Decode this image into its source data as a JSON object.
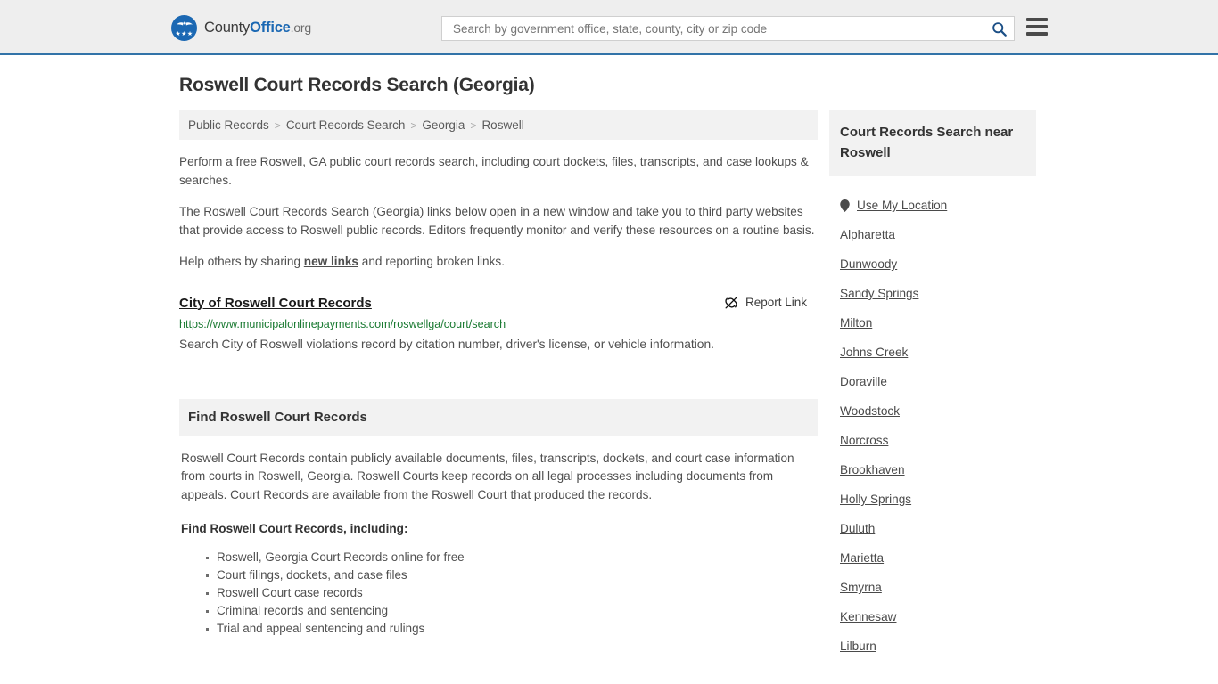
{
  "header": {
    "brand": {
      "part1": "County",
      "part2": "Office",
      "part3": ".org",
      "logo_icon": "eagle-shield-logo",
      "stars": "★★★"
    },
    "search": {
      "placeholder": "Search by government office, state, county, city or zip code",
      "value": "",
      "icon": "search-icon"
    },
    "menu_icon": "hamburger-menu-icon",
    "accent_color": "#3273a8"
  },
  "page": {
    "title": "Roswell Court Records Search (Georgia)"
  },
  "breadcrumb": {
    "separator": ">",
    "items": [
      {
        "label": "Public Records"
      },
      {
        "label": "Court Records Search"
      },
      {
        "label": "Georgia"
      },
      {
        "label": "Roswell"
      }
    ]
  },
  "intro": {
    "p1": "Perform a free Roswell, GA public court records search, including court dockets, files, transcripts, and case lookups & searches.",
    "p2": "The Roswell Court Records Search (Georgia) links below open in a new window and take you to third party websites that provide access to Roswell public records. Editors frequently monitor and verify these resources on a routine basis.",
    "p3_before": "Help others by sharing ",
    "p3_link": "new links",
    "p3_after": " and reporting broken links."
  },
  "result": {
    "title": "City of Roswell Court Records",
    "url": "https://www.municipalonlinepayments.com/roswellga/court/search",
    "description": "Search City of Roswell violations record by citation number, driver's license, or vehicle information.",
    "report_label": "Report Link",
    "report_icon": "broken-link-icon",
    "url_color": "#1a7a32"
  },
  "section": {
    "heading": "Find Roswell Court Records",
    "paragraph": "Roswell Court Records contain publicly available documents, files, transcripts, dockets, and court case information from courts in Roswell, Georgia. Roswell Courts keep records on all legal processes including documents from appeals. Court Records are available from the Roswell Court that produced the records.",
    "list_lead": "Find Roswell Court Records, including:",
    "bullets": [
      "Roswell, Georgia Court Records online for free",
      "Court filings, dockets, and case files",
      "Roswell Court case records",
      "Criminal records and sentencing",
      "Trial and appeal sentencing and rulings"
    ]
  },
  "sidebar": {
    "heading": "Court Records Search near Roswell",
    "use_location": {
      "label": "Use My Location",
      "icon": "map-pin-icon"
    },
    "cities": [
      {
        "label": "Alpharetta"
      },
      {
        "label": "Dunwoody"
      },
      {
        "label": "Sandy Springs"
      },
      {
        "label": "Milton"
      },
      {
        "label": "Johns Creek"
      },
      {
        "label": "Doraville"
      },
      {
        "label": "Woodstock"
      },
      {
        "label": "Norcross"
      },
      {
        "label": "Brookhaven"
      },
      {
        "label": "Holly Springs"
      },
      {
        "label": "Duluth"
      },
      {
        "label": "Marietta"
      },
      {
        "label": "Smyrna"
      },
      {
        "label": "Kennesaw"
      },
      {
        "label": "Lilburn"
      }
    ]
  }
}
